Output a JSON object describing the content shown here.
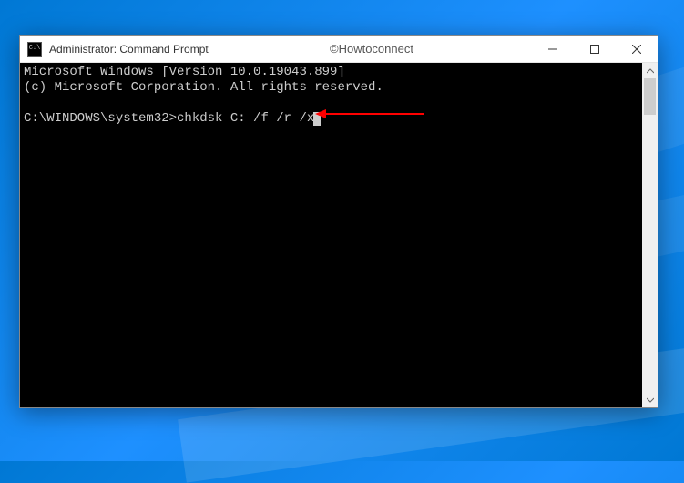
{
  "window": {
    "title": "Administrator: Command Prompt",
    "watermark": "©Howtoconnect"
  },
  "terminal": {
    "line1": "Microsoft Windows [Version 10.0.19043.899]",
    "line2": "(c) Microsoft Corporation. All rights reserved.",
    "blank": "",
    "prompt": "C:\\WINDOWS\\system32>",
    "command": "chkdsk C: /f /r /x"
  },
  "annotation": {
    "arrow_color": "#ff0000"
  }
}
